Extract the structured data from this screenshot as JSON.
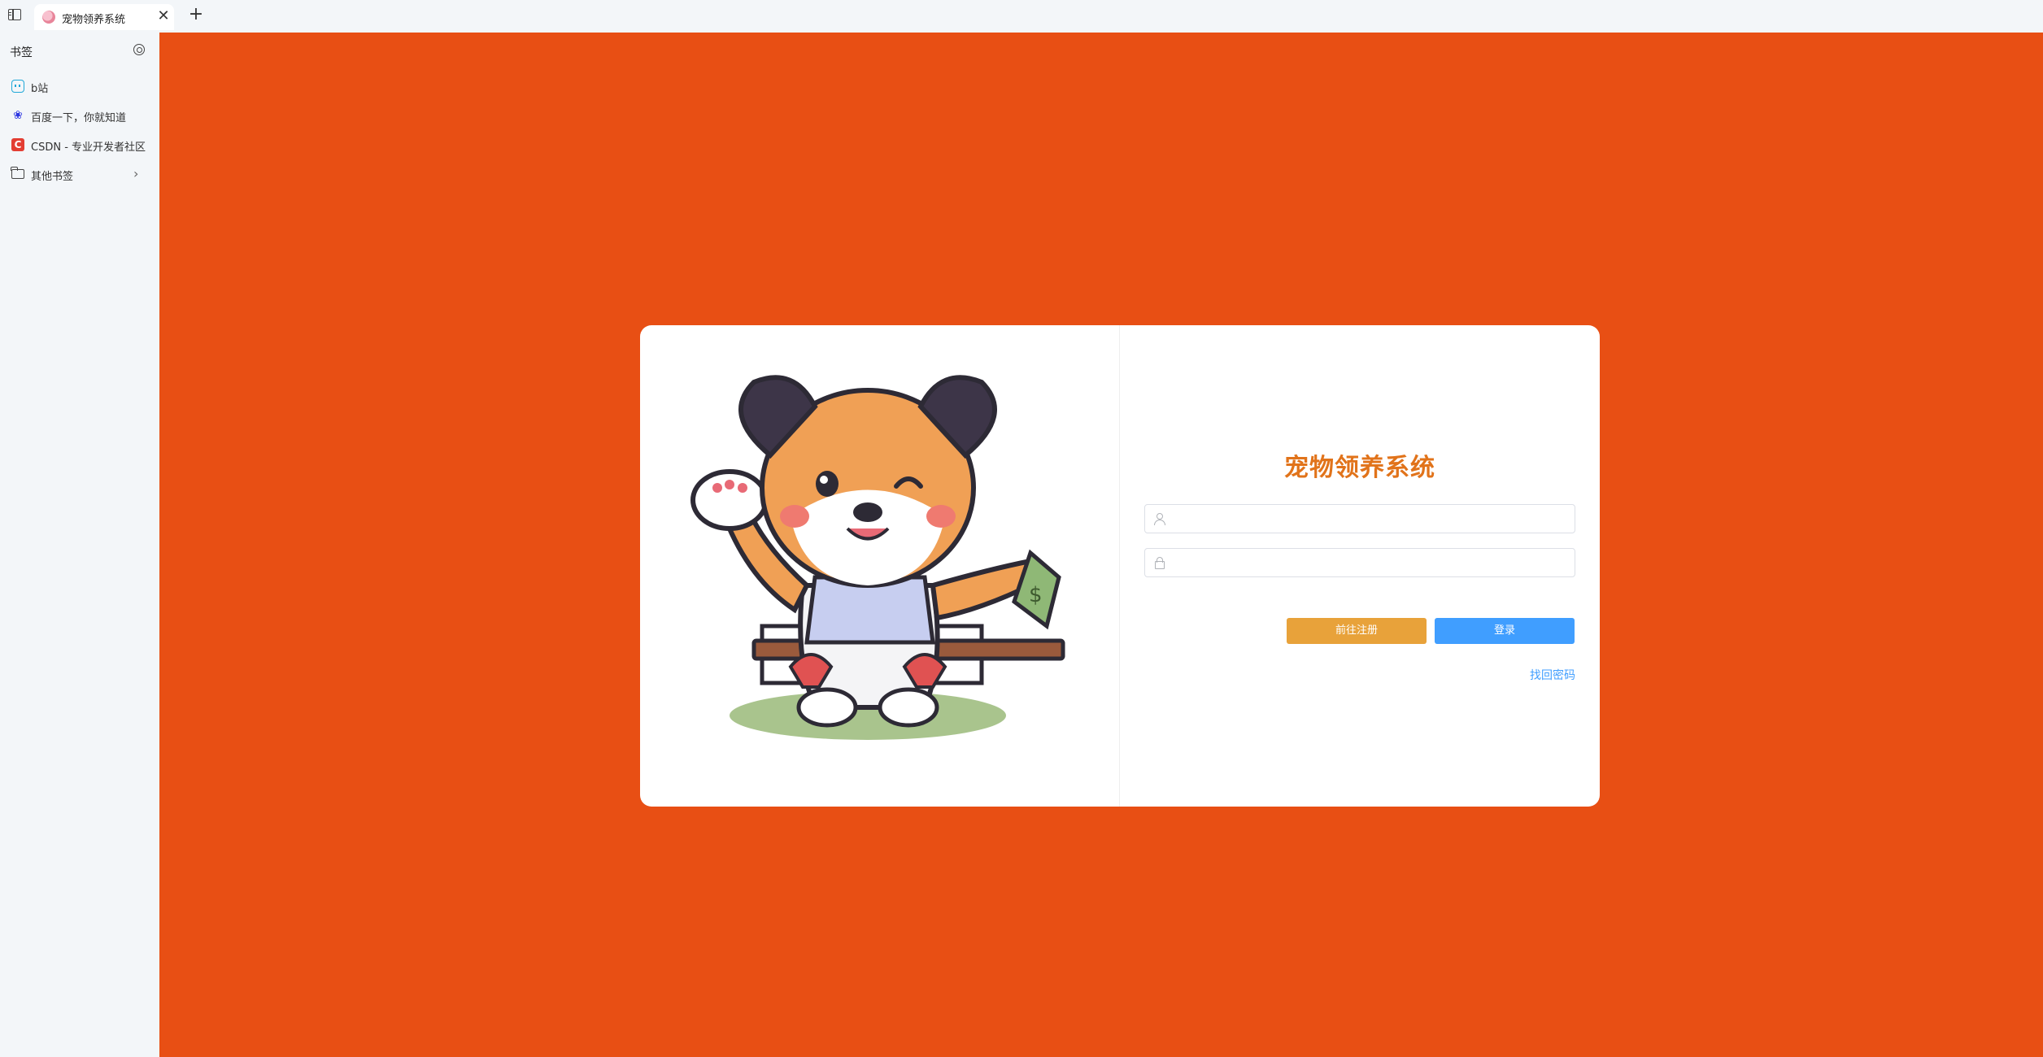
{
  "browser": {
    "tab": {
      "title": "宠物领养系统"
    },
    "new_tab_label": "+",
    "close_label": "✕"
  },
  "sidebar": {
    "title": "书签",
    "bookmarks": [
      {
        "label": "b站",
        "icon": "bilibili-icon"
      },
      {
        "label": "百度一下，你就知道",
        "icon": "baidu-icon"
      },
      {
        "label": "CSDN - 专业开发者社区",
        "icon": "csdn-icon"
      },
      {
        "label": "其他书签",
        "icon": "folder-icon"
      }
    ]
  },
  "login": {
    "title": "宠物领养系统",
    "username": {
      "value": "",
      "placeholder": ""
    },
    "password": {
      "value": "",
      "placeholder": ""
    },
    "register_label": "前往注册",
    "login_label": "登录",
    "forgot_label": "找回密码"
  },
  "colors": {
    "page_background": "#e84f14",
    "title": "#e1731a",
    "register_button": "#e8a23a",
    "login_button": "#409eff"
  }
}
